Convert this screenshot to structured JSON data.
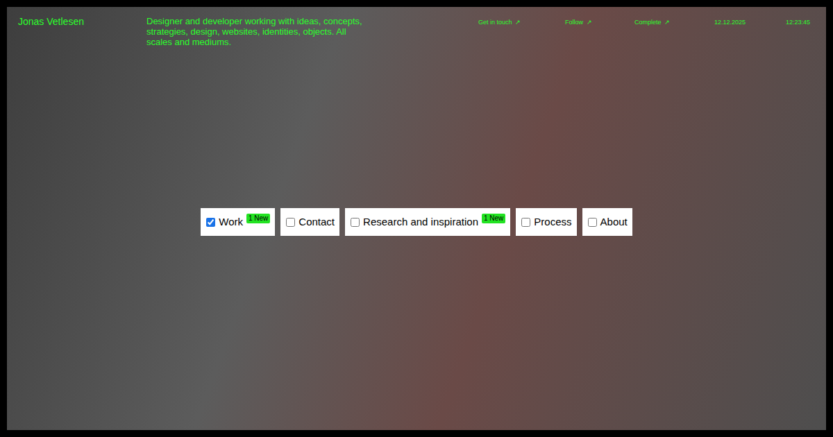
{
  "site": {
    "name": "Jonas Vetlesen",
    "tagline": "Designer and developer working with ideas, concepts, strategies, design, websites, identities, objects. All scales and mediums."
  },
  "links": [
    {
      "label": "Get in touch",
      "arrow": "↗"
    },
    {
      "label": "Follow",
      "arrow": "↗"
    },
    {
      "label": "Complete",
      "arrow": "↗"
    }
  ],
  "date": "12.12.2025",
  "time": "12:23:45",
  "nav": [
    {
      "label": "Work",
      "checked": true,
      "badge": "1 New"
    },
    {
      "label": "Contact",
      "checked": false
    },
    {
      "label": "Research and inspiration",
      "checked": false,
      "badge": "1 New"
    },
    {
      "label": "Process",
      "checked": false
    },
    {
      "label": "About",
      "checked": false
    }
  ]
}
